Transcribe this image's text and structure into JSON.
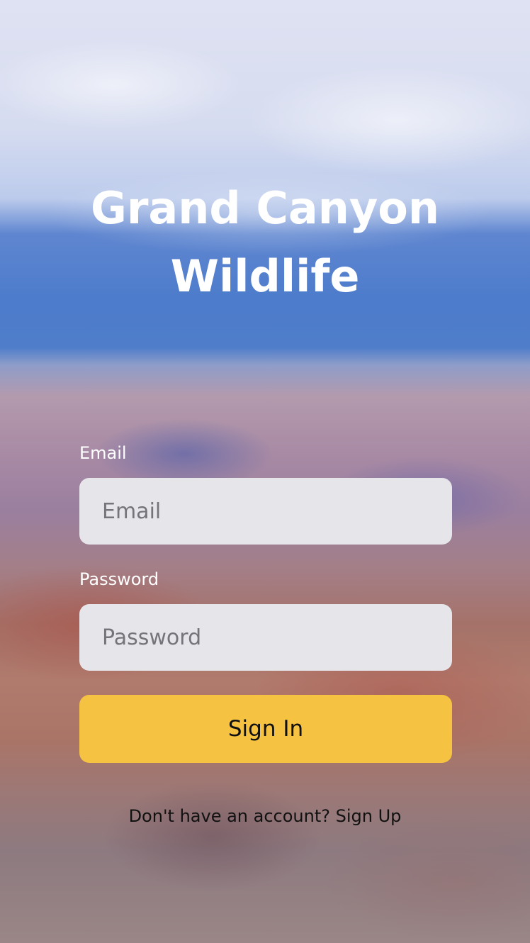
{
  "header": {
    "title_line1": "Grand Canyon",
    "title_line2": "Wildlife"
  },
  "form": {
    "email_label": "Email",
    "email_placeholder": "Email",
    "password_label": "Password",
    "password_placeholder": "Password",
    "submit_label": "Sign In"
  },
  "footer": {
    "prompt": "Don't have an account?",
    "signup_link": "Sign Up"
  },
  "colors": {
    "button": "#f5c242",
    "input_bg": "#e6e5ea",
    "title": "#ffffff"
  }
}
